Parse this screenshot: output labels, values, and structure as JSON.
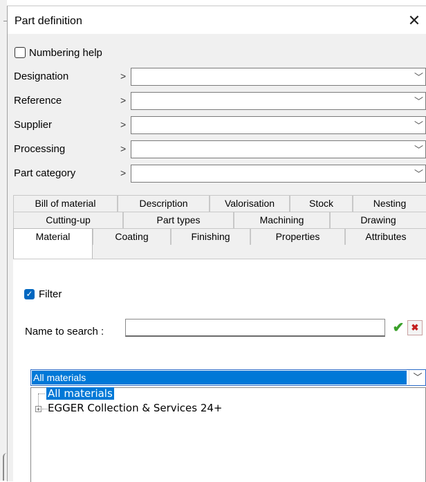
{
  "dialog": {
    "title": "Part definition",
    "close_glyph": "✕"
  },
  "numbering_help": {
    "label": "Numbering help",
    "checked": false
  },
  "fields": [
    {
      "label": "Designation",
      "arrow": ">",
      "value": "",
      "chevron": "﹀"
    },
    {
      "label": "Reference",
      "arrow": ">",
      "value": "",
      "chevron": "﹀"
    },
    {
      "label": "Supplier",
      "arrow": ">",
      "value": "",
      "chevron": "﹀"
    },
    {
      "label": "Processing",
      "arrow": ">",
      "value": "",
      "chevron": "﹀"
    },
    {
      "label": "Part category",
      "arrow": ">",
      "value": "",
      "chevron": "﹀"
    }
  ],
  "tabs": {
    "row1": [
      "Bill of material",
      "Description",
      "Valorisation",
      "Stock",
      "Nesting"
    ],
    "row2": [
      "Cutting-up",
      "Part types",
      "Machining",
      "Drawing"
    ],
    "row3": [
      "Material",
      "Coating",
      "Finishing",
      "Properties",
      "Attributes"
    ],
    "active": "Material"
  },
  "material": {
    "filter_label": "Filter",
    "filter_checked": true,
    "check_glyph": "✓",
    "search_label": "Name to search :",
    "search_value": "",
    "ok_glyph": "✔",
    "cancel_glyph": "✖",
    "select_value": "All materials",
    "select_chevron": "﹀",
    "tree": {
      "items": [
        {
          "label": "All materials",
          "selected": true
        },
        {
          "label": "EGGER Collection & Services 24+",
          "expander": "+"
        }
      ]
    }
  }
}
